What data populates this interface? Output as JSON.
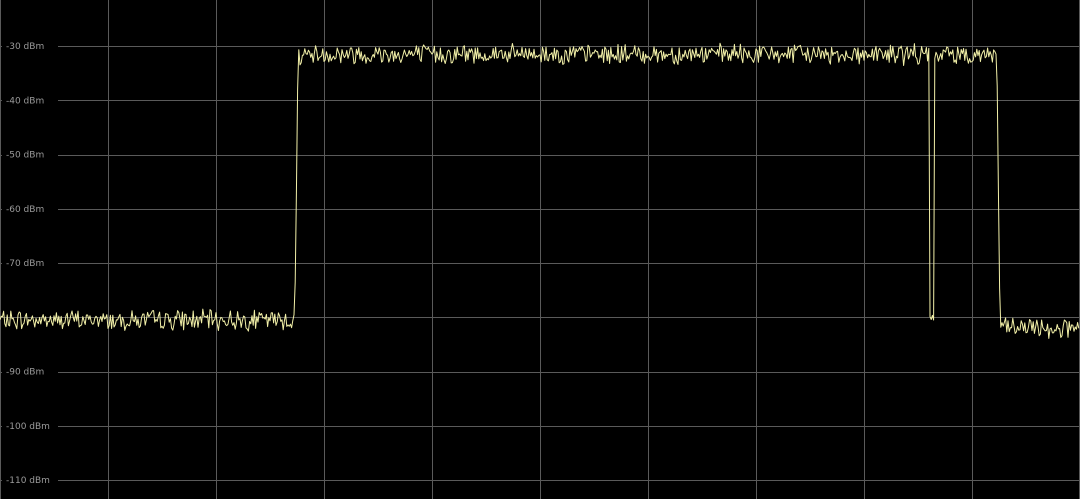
{
  "colors": {
    "background": "#000000",
    "grid": "#5a5a5a",
    "trace": "#f2f0a8",
    "tick_label": "#9a9a9a"
  },
  "chart_data": {
    "type": "line",
    "y_unit": "dBm",
    "ylim": [
      -113.5,
      -21.5
    ],
    "xlim": [
      0,
      100
    ],
    "grid": true,
    "y_ticks": [
      {
        "value": -30,
        "label": "-30 dBm"
      },
      {
        "value": -40,
        "label": "-40 dBm"
      },
      {
        "value": -50,
        "label": "-50 dBm"
      },
      {
        "value": -60,
        "label": "-60 dBm"
      },
      {
        "value": -70,
        "label": "-70 dBm"
      },
      {
        "value": -90,
        "label": "-90 dBm"
      },
      {
        "value": -100,
        "label": "-100 dBm"
      },
      {
        "value": -110,
        "label": "-110 dBm"
      }
    ],
    "x_gridlines": [
      0,
      10,
      20,
      30,
      40,
      50,
      60,
      70,
      80,
      90,
      100
    ],
    "series": [
      {
        "segments": [
          {
            "x": [
              0,
              27.3
            ],
            "level": -80.5
          },
          {
            "x": [
              27.6,
              86.0
            ],
            "level": -31.5
          },
          {
            "x": [
              86.5,
              92.3
            ],
            "level": -31.5
          },
          {
            "x": [
              92.6,
              100
            ],
            "level": -82.0
          }
        ],
        "dips": [
          {
            "x": 86.3,
            "value": -80.0
          }
        ],
        "noise_ripple_db": 1.5
      }
    ]
  }
}
